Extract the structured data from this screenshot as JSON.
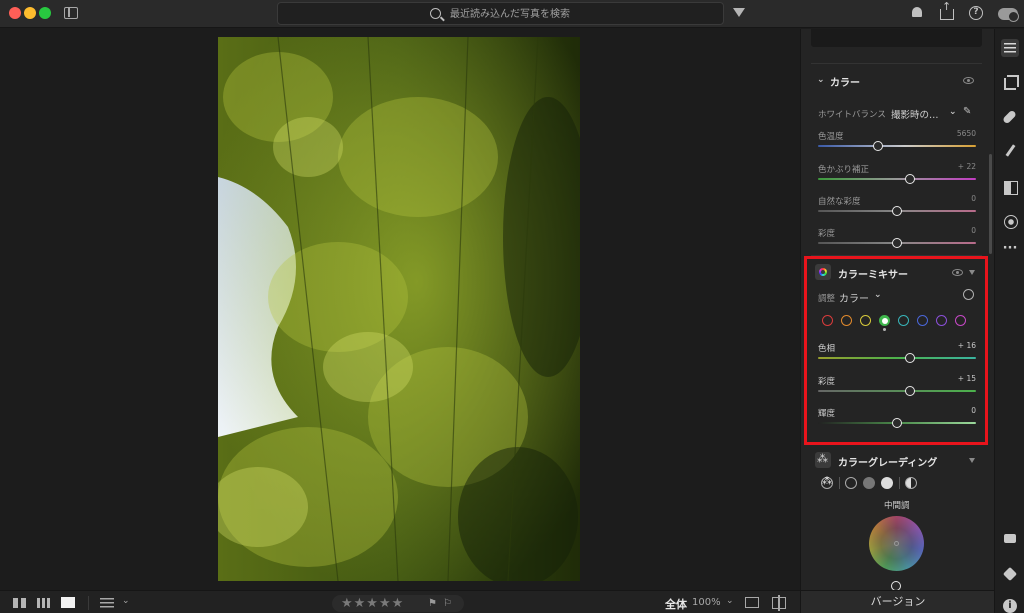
{
  "search": {
    "placeholder": "最近読み込んだ写真を検索"
  },
  "color_section": {
    "title": "カラー",
    "wb_label": "ホワイトバランス",
    "wb_value": "撮影時の…",
    "sliders": [
      {
        "label": "色温度",
        "value": "5650",
        "position": 0.38
      },
      {
        "label": "色かぶり補正",
        "value": "+ 22",
        "position": 0.58
      },
      {
        "label": "自然な彩度",
        "value": "0",
        "position": 0.5
      },
      {
        "label": "彩度",
        "value": "0",
        "position": 0.5
      }
    ]
  },
  "color_mixer": {
    "title": "カラーミキサー",
    "adjust_label": "調整",
    "adjust_value": "カラー",
    "swatches": [
      {
        "name": "red",
        "color": "#d83b3b"
      },
      {
        "name": "orange",
        "color": "#e0892c"
      },
      {
        "name": "yellow",
        "color": "#d6c83a"
      },
      {
        "name": "green",
        "color": "#3fb64c",
        "active": true
      },
      {
        "name": "aqua",
        "color": "#37b4b8"
      },
      {
        "name": "blue",
        "color": "#4a66d8"
      },
      {
        "name": "purple",
        "color": "#8a4fd8"
      },
      {
        "name": "magenta",
        "color": "#c648c6"
      }
    ],
    "sliders": [
      {
        "label": "色相",
        "value": "+ 16",
        "position": 0.58
      },
      {
        "label": "彩度",
        "value": "+ 15",
        "position": 0.58
      },
      {
        "label": "輝度",
        "value": "0",
        "position": 0.5
      }
    ]
  },
  "color_grading": {
    "title": "カラーグレーディング",
    "midtones_label": "中間調"
  },
  "bottom_bar": {
    "zoom_label": "全体",
    "zoom_value": "100%",
    "stars": "★★★★★"
  },
  "panel_footer": {
    "version_label": "バージョン"
  },
  "colors": {
    "accent_highlight": "#e8141c",
    "panel_bg": "#242424",
    "app_bg": "#1c1c1c"
  }
}
